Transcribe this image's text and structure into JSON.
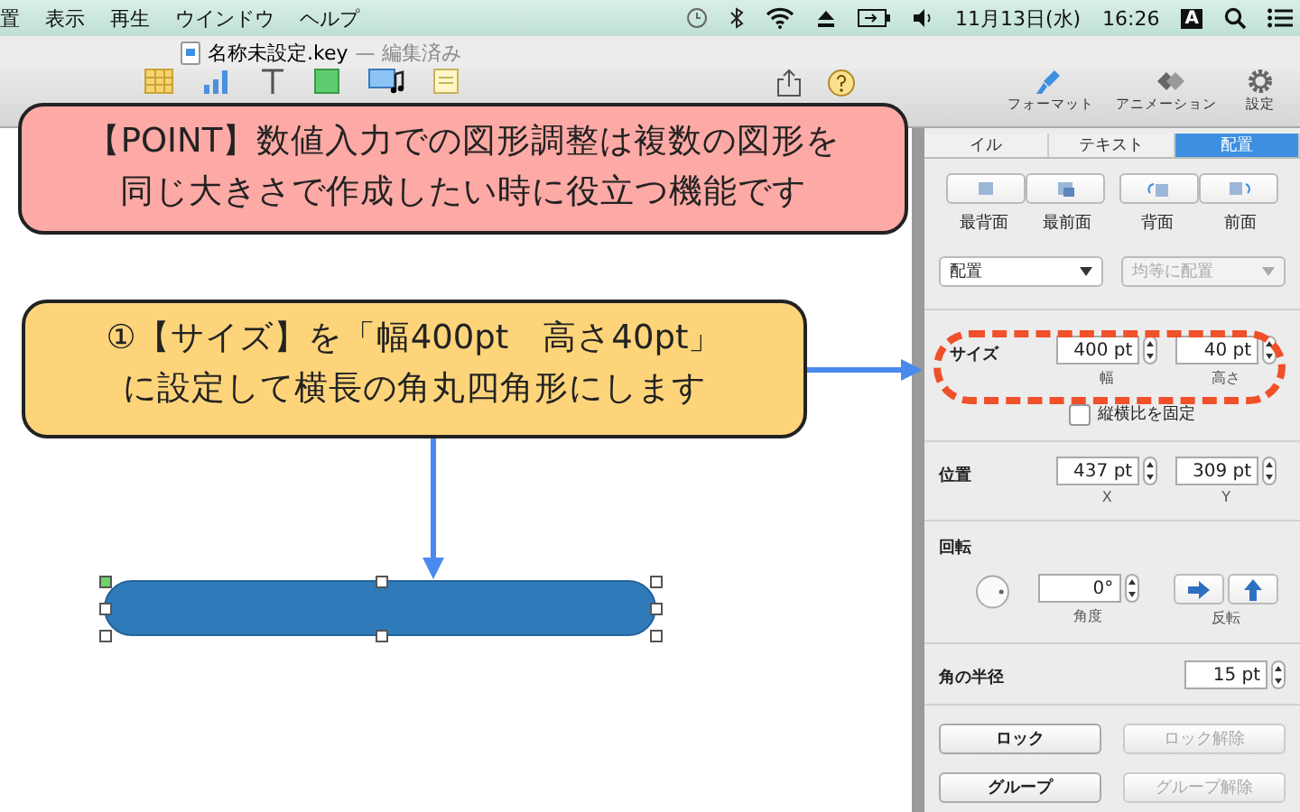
{
  "menu_bar": {
    "items": [
      "置",
      "表示",
      "再生",
      "ウインドウ",
      "ヘルプ"
    ],
    "date": "11月13日(水)",
    "time": "16:26",
    "input_source": "A"
  },
  "document": {
    "title": "名称未設定.key",
    "status": "— 編集済み"
  },
  "toolbar": {
    "inspector_buttons": [
      "フォーマット",
      "アニメーション",
      "設定"
    ]
  },
  "inspector": {
    "tabs": [
      {
        "label": "イル",
        "selected": false
      },
      {
        "label": "テキスト",
        "selected": false
      },
      {
        "label": "配置",
        "selected": true
      }
    ],
    "order_captions": [
      "最背面",
      "最前面",
      "背面",
      "前面"
    ],
    "dropdowns": [
      {
        "value": "配置",
        "disabled": false
      },
      {
        "value": "均等に配置",
        "disabled": true
      }
    ],
    "size": {
      "label": "サイズ",
      "fields": [
        {
          "value": "400 pt",
          "caption": "幅"
        },
        {
          "value": "40 pt",
          "caption": "高さ"
        }
      ],
      "constrain": {
        "label": "縦横比を固定",
        "checked": false
      }
    },
    "position": {
      "label": "位置",
      "fields": [
        {
          "value": "437 pt",
          "caption": "X"
        },
        {
          "value": "309 pt",
          "caption": "Y"
        }
      ]
    },
    "rotate": {
      "label": "回転",
      "angle": {
        "value": "0°",
        "caption": "角度"
      },
      "flip_caption": "反転"
    },
    "corner_radius": {
      "label": "角の半径",
      "value": "15 pt"
    },
    "buttons": [
      {
        "label": "ロック",
        "disabled": false
      },
      {
        "label": "ロック解除",
        "disabled": true
      },
      {
        "label": "グループ",
        "disabled": false
      },
      {
        "label": "グループ解除",
        "disabled": true
      }
    ]
  },
  "callouts": [
    {
      "kind": "point",
      "lines": [
        "【POINT】数値入力での図形調整は複数の図形を",
        "同じ大きさで作成したい時に役立つ機能です"
      ]
    },
    {
      "kind": "step",
      "lines": [
        "①【サイズ】を「幅400pt　高さ40pt」",
        "に設定して横長の角丸四角形にします"
      ]
    }
  ]
}
